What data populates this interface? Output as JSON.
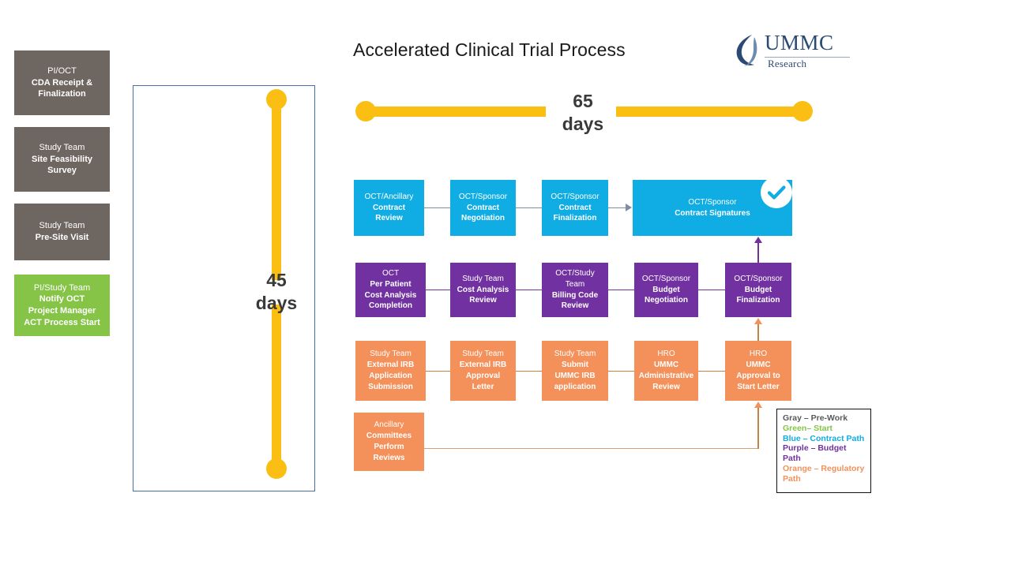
{
  "page_title": "Accelerated Clinical Trial Process",
  "logo": {
    "wordmark": "UMMC",
    "subtitle": "Research",
    "mark_name": "ummc-swoosh-icon"
  },
  "timeline_top": {
    "label_line1": "65",
    "label_line2": "days"
  },
  "timeline_left": {
    "label_line1": "45",
    "label_line2": "days"
  },
  "prework_boxes": [
    {
      "color": "#6E6661",
      "lines": [
        "PI/OCT",
        "CDA Receipt &",
        "Finalization"
      ],
      "bold_from": 1
    },
    {
      "color": "#6E6661",
      "lines": [
        "Study Team",
        "Site Feasibility",
        "Survey"
      ],
      "bold_from": 1
    },
    {
      "color": "#6E6661",
      "lines": [
        "Study Team",
        "Pre-Site Visit"
      ],
      "bold_from": 1
    },
    {
      "color": "#85C446",
      "lines": [
        "PI/Study Team",
        "Notify OCT",
        "Project Manager",
        "ACT Process Start"
      ],
      "bold_from": 1
    }
  ],
  "contract_row": {
    "color": "#0FADE4",
    "boxes": [
      {
        "lines": [
          "OCT/Ancillary",
          "Contract",
          "Review"
        ],
        "bold_from": 1
      },
      {
        "lines": [
          "OCT/Sponsor",
          "Contract",
          "Negotiation"
        ],
        "bold_from": 1
      },
      {
        "lines": [
          "OCT/Sponsor",
          "Contract",
          "Finalization"
        ],
        "bold_from": 1
      },
      {
        "lines": [
          "OCT/Sponsor",
          "Contract Signatures"
        ],
        "bold_from": 1
      }
    ],
    "badge": "check-icon"
  },
  "budget_row": {
    "color": "#7131A1",
    "boxes": [
      {
        "lines": [
          "OCT",
          "Per Patient",
          "Cost Analysis",
          "Completion"
        ],
        "bold_from": 1
      },
      {
        "lines": [
          "Study Team",
          "Cost Analysis",
          "Review"
        ],
        "bold_from": 1
      },
      {
        "lines": [
          "OCT/Study",
          "Team",
          "Billing Code",
          "Review"
        ],
        "bold_from": 2
      },
      {
        "lines": [
          "OCT/Sponsor",
          "Budget",
          "Negotiation"
        ],
        "bold_from": 1
      },
      {
        "lines": [
          "OCT/Sponsor",
          "Budget",
          "Finalization"
        ],
        "bold_from": 1
      }
    ]
  },
  "regulatory_row": {
    "color": "#F4905A",
    "boxes": [
      {
        "lines": [
          "Study Team",
          "External IRB",
          "Application",
          "Submission"
        ],
        "bold_from": 1
      },
      {
        "lines": [
          "Study Team",
          "External IRB",
          "Approval",
          "Letter"
        ],
        "bold_from": 1
      },
      {
        "lines": [
          "Study Team",
          "Submit",
          "UMMC IRB",
          "application"
        ],
        "bold_from": 1
      },
      {
        "lines": [
          "HRO",
          "UMMC",
          "Administrative",
          "Review"
        ],
        "bold_from": 1
      },
      {
        "lines": [
          "HRO",
          "UMMC",
          "Approval to",
          "Start Letter"
        ],
        "bold_from": 1
      }
    ]
  },
  "ancillary_box": {
    "color": "#F4905A",
    "lines": [
      "Ancillary",
      "Committees",
      "Perform",
      "Reviews"
    ],
    "bold_from": 1
  },
  "legend": {
    "items": [
      {
        "text": "Gray – Pre-Work",
        "color": "#595959",
        "class": "lg-gray"
      },
      {
        "text": "Green– Start",
        "color": "#85C446",
        "class": "lg-green"
      },
      {
        "text": "Blue – Contract Path",
        "color": "#0FADE4",
        "class": "lg-blue"
      },
      {
        "text": "Purple – Budget Path",
        "color": "#7131A1",
        "class": "lg-purple"
      },
      {
        "text": "Orange – Regulatory Path",
        "color": "#F4905A",
        "class": "lg-orange"
      }
    ]
  },
  "colors": {
    "yellow": "#FBBF14",
    "gray": "#6E6661",
    "green": "#85C446",
    "blue": "#0FADE4",
    "purple": "#7131A1",
    "orange": "#F4905A",
    "panel_border": "#4472a8",
    "logo_blue": "#2b4a73"
  }
}
